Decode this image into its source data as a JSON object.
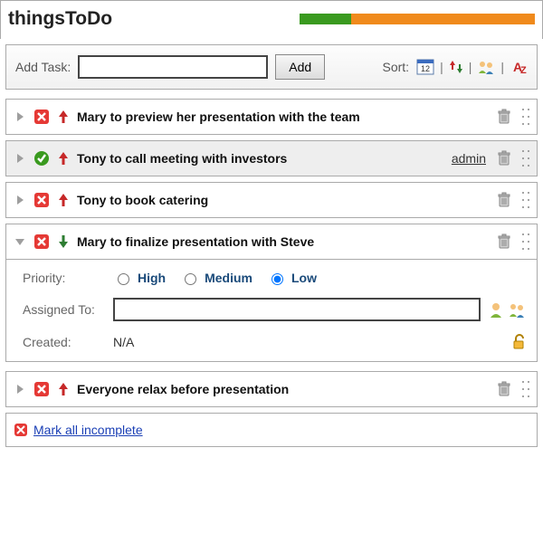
{
  "app_title": "thingsToDo",
  "progress": {
    "done_pct": 22,
    "remain_pct": 78
  },
  "add": {
    "label": "Add Task:",
    "button": "Add",
    "value": ""
  },
  "sort": {
    "label": "Sort:"
  },
  "tasks": [
    {
      "title": "Mary to preview her presentation with the team",
      "status": "incomplete",
      "priority": "up",
      "expanded": false
    },
    {
      "title": "Tony to call meeting with investors",
      "status": "complete",
      "priority": "up",
      "expanded": false,
      "owner": "admin",
      "selected": true
    },
    {
      "title": "Tony to book catering",
      "status": "incomplete",
      "priority": "up",
      "expanded": false
    },
    {
      "title": "Mary to finalize presentation with Steve",
      "status": "incomplete",
      "priority": "down",
      "expanded": true
    },
    {
      "title": "Everyone relax before presentation",
      "status": "incomplete",
      "priority": "up",
      "expanded": false
    }
  ],
  "details": {
    "priority_label": "Priority:",
    "priority_options": {
      "high": "High",
      "medium": "Medium",
      "low": "Low"
    },
    "priority_value": "low",
    "assigned_label": "Assigned To:",
    "assigned_value": "",
    "created_label": "Created:",
    "created_value": "N/A"
  },
  "footer": {
    "mark_all": "Mark all incomplete"
  }
}
